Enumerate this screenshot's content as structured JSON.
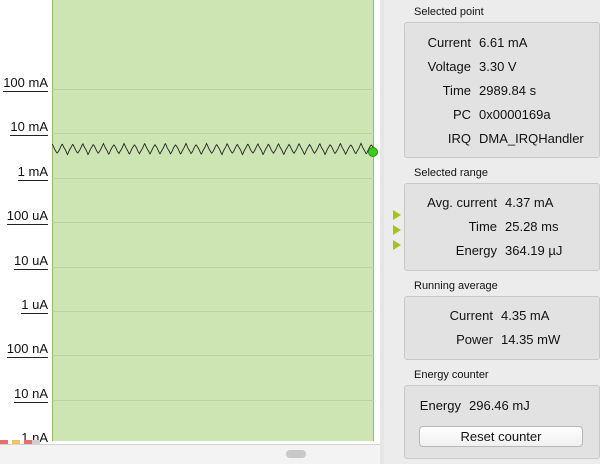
{
  "plot": {
    "y_ticks": [
      "100 mA",
      "10 mA",
      "1 mA",
      "100 uA",
      "10 uA",
      "1 uA",
      "100 nA",
      "10 nA",
      "1 nA"
    ]
  },
  "selected_point": {
    "title": "Selected point",
    "current_label": "Current",
    "current_value": "6.61 mA",
    "voltage_label": "Voltage",
    "voltage_value": "3.30 V",
    "time_label": "Time",
    "time_value": "2989.84 s",
    "pc_label": "PC",
    "pc_value": "0x0000169a",
    "irq_label": "IRQ",
    "irq_value": "DMA_IRQHandler"
  },
  "selected_range": {
    "title": "Selected range",
    "avg_label": "Avg. current",
    "avg_value": "4.37 mA",
    "time_label": "Time",
    "time_value": "25.28 ms",
    "energy_label": "Energy",
    "energy_value": "364.19 µJ"
  },
  "running_average": {
    "title": "Running average",
    "current_label": "Current",
    "current_value": "4.35 mA",
    "power_label": "Power",
    "power_value": "14.35 mW"
  },
  "energy_counter": {
    "title": "Energy counter",
    "energy_label": "Energy",
    "energy_value": "296.46 mJ",
    "reset_label": "Reset counter"
  },
  "colors": {
    "selection_fill": "#cde5b3",
    "marker": "#3acb1d",
    "range_arrow": "#a7c21b"
  }
}
